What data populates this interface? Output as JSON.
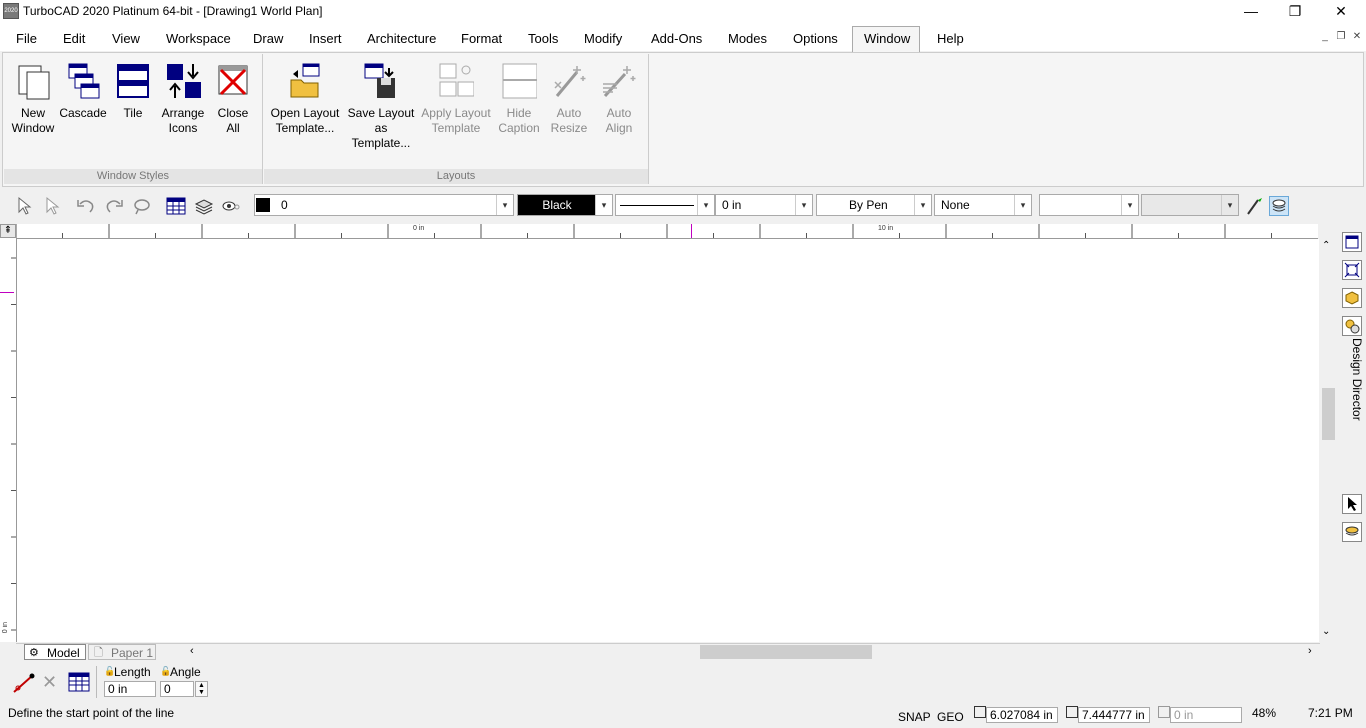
{
  "window": {
    "title": "TurboCAD 2020 Platinum 64-bit - [Drawing1 World Plan]",
    "app_icon_text": "2020",
    "minimize": "—",
    "maximize": "❐",
    "close": "✕"
  },
  "menu": [
    "File",
    "Edit",
    "View",
    "Workspace",
    "Draw",
    "Insert",
    "Architecture",
    "Format",
    "Tools",
    "Modify",
    "Add-Ons",
    "Modes",
    "Options",
    "Window",
    "Help"
  ],
  "mdi_controls": [
    "_",
    "❐",
    "✕"
  ],
  "ribbon": {
    "window_styles": {
      "label": "Window Styles",
      "buttons": [
        {
          "line1": "New",
          "line2": "Window"
        },
        {
          "line1": "Cascade",
          "line2": ""
        },
        {
          "line1": "Tile",
          "line2": ""
        },
        {
          "line1": "Arrange",
          "line2": "Icons"
        },
        {
          "line1": "Close",
          "line2": "All"
        }
      ]
    },
    "layouts": {
      "label": "Layouts",
      "buttons": [
        {
          "line1": "Open Layout",
          "line2": "Template..."
        },
        {
          "line1": "Save Layout",
          "line2": "as Template..."
        },
        {
          "line1": "Apply Layout",
          "line2": "Template"
        },
        {
          "line1": "Hide",
          "line2": "Caption"
        },
        {
          "line1": "Auto",
          "line2": "Resize"
        },
        {
          "line1": "Auto",
          "line2": "Align"
        }
      ]
    }
  },
  "properties": {
    "layer_value": "0",
    "color_value": "Black",
    "line_width": "0 in",
    "pen": "By Pen",
    "fill": "None",
    "arrow": "▾",
    "color_black": "#000000"
  },
  "ruler": {
    "label_0": "0 in",
    "label_10": "10 in",
    "v_label": "0 in"
  },
  "tabs": {
    "model": "Model",
    "paper": "Paper 1"
  },
  "input": {
    "length_label": "Length",
    "angle_label": "Angle",
    "length_value": "0 in",
    "angle_value": "0"
  },
  "status": {
    "prompt": "Define the start point of the line",
    "snap": "SNAP",
    "geo": "GEO",
    "x_value": "6.027084 in",
    "y_value": "7.444777 in",
    "z_value": "0 in",
    "zoom": "48%",
    "time": "7:21 PM"
  },
  "side_panel": {
    "label": "Design Director"
  }
}
